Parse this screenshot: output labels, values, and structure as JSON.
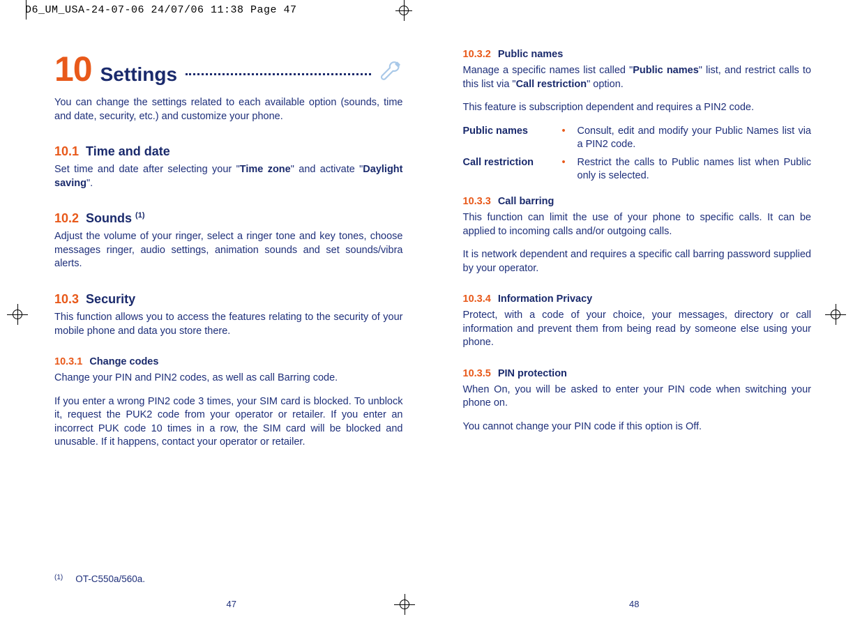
{
  "slug": "D6_UM_USA-24-07-06  24/07/06  11:38  Page 47",
  "left": {
    "chapter_number": "10",
    "chapter_title": "Settings",
    "intro": "You can change the settings related to each available option (sounds, time and date, security, etc.) and customize your phone.",
    "s1_num": "10.1",
    "s1_title": "Time and date",
    "s1_p_a": "Set time and date after selecting your \"",
    "s1_p_b": "Time zone",
    "s1_p_c": "\" and activate \"",
    "s1_p_d": "Daylight saving",
    "s1_p_e": "\".",
    "s2_num": "10.2",
    "s2_title": "Sounds ",
    "s2_sup": "(1)",
    "s2_p": "Adjust the volume of your ringer, select a ringer tone and key tones, choose messages ringer, audio settings, animation sounds and set sounds/vibra alerts.",
    "s3_num": "10.3",
    "s3_title": "Security",
    "s3_p": "This function allows you to access the features relating to the security of your mobile phone and data you store there.",
    "s31_num": "10.3.1",
    "s31_title": "Change codes",
    "s31_p1": "Change your PIN and PIN2 codes, as well as call Barring code.",
    "s31_p2": "If you enter a wrong PIN2 code 3 times, your SIM card is blocked. To unblock it, request the PUK2 code from your operator or retailer. If you enter an incorrect PUK code 10 times in a row, the SIM card will be blocked and unusable. If it happens, contact your operator or retailer.",
    "fn_mark": "(1)",
    "fn_text": "OT-C550a/560a.",
    "pagenum": "47"
  },
  "right": {
    "s32_num": "10.3.2",
    "s32_title": "Public names",
    "s32_p1_a": "Manage a specific names list called \"",
    "s32_p1_b": "Public names",
    "s32_p1_c": "\" list, and restrict calls to this list via \"",
    "s32_p1_d": "Call restriction",
    "s32_p1_e": "\" option.",
    "s32_p2": "This feature is subscription dependent and requires a PIN2 code.",
    "def1_term": "Public names",
    "def1_desc": "Consult, edit and modify your Public Names list via a PIN2 code.",
    "def2_term": "Call restriction",
    "def2_desc": "Restrict the calls to Public names list when Public only is selected.",
    "s33_num": "10.3.3",
    "s33_title": "Call barring",
    "s33_p1": "This function can limit the use of your phone to specific calls. It can be applied to incoming calls and/or outgoing calls.",
    "s33_p2": "It is network dependent and requires a specific call barring password supplied by your operator.",
    "s34_num": "10.3.4",
    "s34_title": "Information Privacy",
    "s34_p": "Protect, with a code of your choice, your messages, directory or call information and prevent them from being read by someone else using your phone.",
    "s35_num": "10.3.5",
    "s35_title": "PIN protection",
    "s35_p1": "When On, you will be asked to enter your PIN code when switching your phone on.",
    "s35_p2": "You cannot change your PIN code if this option is Off.",
    "pagenum": "48"
  }
}
